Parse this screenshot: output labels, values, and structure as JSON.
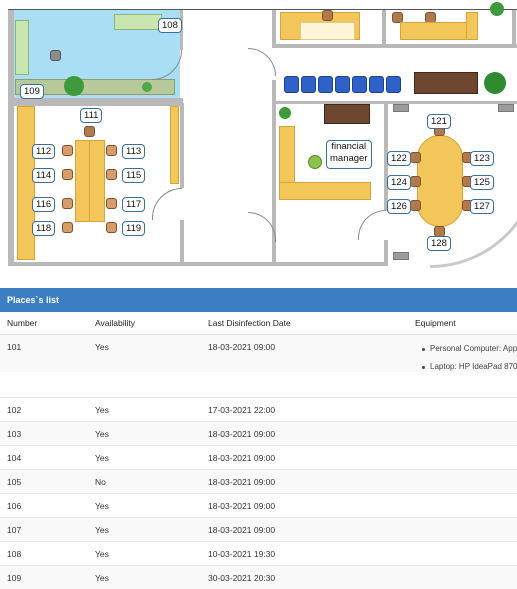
{
  "floor_plan": {
    "place_tags": [
      "108",
      "109",
      "111",
      "112",
      "113",
      "114",
      "115",
      "116",
      "117",
      "118",
      "119",
      "121",
      "122",
      "123",
      "124",
      "125",
      "126",
      "127",
      "128"
    ],
    "manager_label_line1": "financial",
    "manager_label_line2": "manager",
    "colors": {
      "desk": "#f3c65a",
      "room_blue": "#a9def4",
      "wall": "#b9b9b9",
      "tag_border": "#3b6e9c"
    }
  },
  "places_panel": {
    "title": "Places`s list",
    "columns": {
      "number": "Number",
      "availability": "Availability",
      "disinfection": "Last Disinfection Date",
      "equipment": "Equipment"
    },
    "rows": [
      {
        "number": "101",
        "availability": "Yes",
        "date": "18-03-2021 09:00",
        "equipment": [
          "Personal Computer: Appl",
          "Laptop: HP IdeaPad 870|"
        ]
      },
      {
        "number": "102",
        "availability": "Yes",
        "date": "17-03-2021 22:00",
        "equipment": []
      },
      {
        "number": "103",
        "availability": "Yes",
        "date": "18-03-2021 09:00",
        "equipment": []
      },
      {
        "number": "104",
        "availability": "Yes",
        "date": "18-03-2021 09:00",
        "equipment": []
      },
      {
        "number": "105",
        "availability": "No",
        "date": "18-03-2021 09:00",
        "equipment": []
      },
      {
        "number": "106",
        "availability": "Yes",
        "date": "18-03-2021 09:00",
        "equipment": []
      },
      {
        "number": "107",
        "availability": "Yes",
        "date": "18-03-2021 09:00",
        "equipment": []
      },
      {
        "number": "108",
        "availability": "Yes",
        "date": "10-03-2021 19:30",
        "equipment": []
      },
      {
        "number": "109",
        "availability": "Yes",
        "date": "30-03-2021 20:30",
        "equipment": []
      }
    ],
    "header_color": "#3b7ec1"
  }
}
